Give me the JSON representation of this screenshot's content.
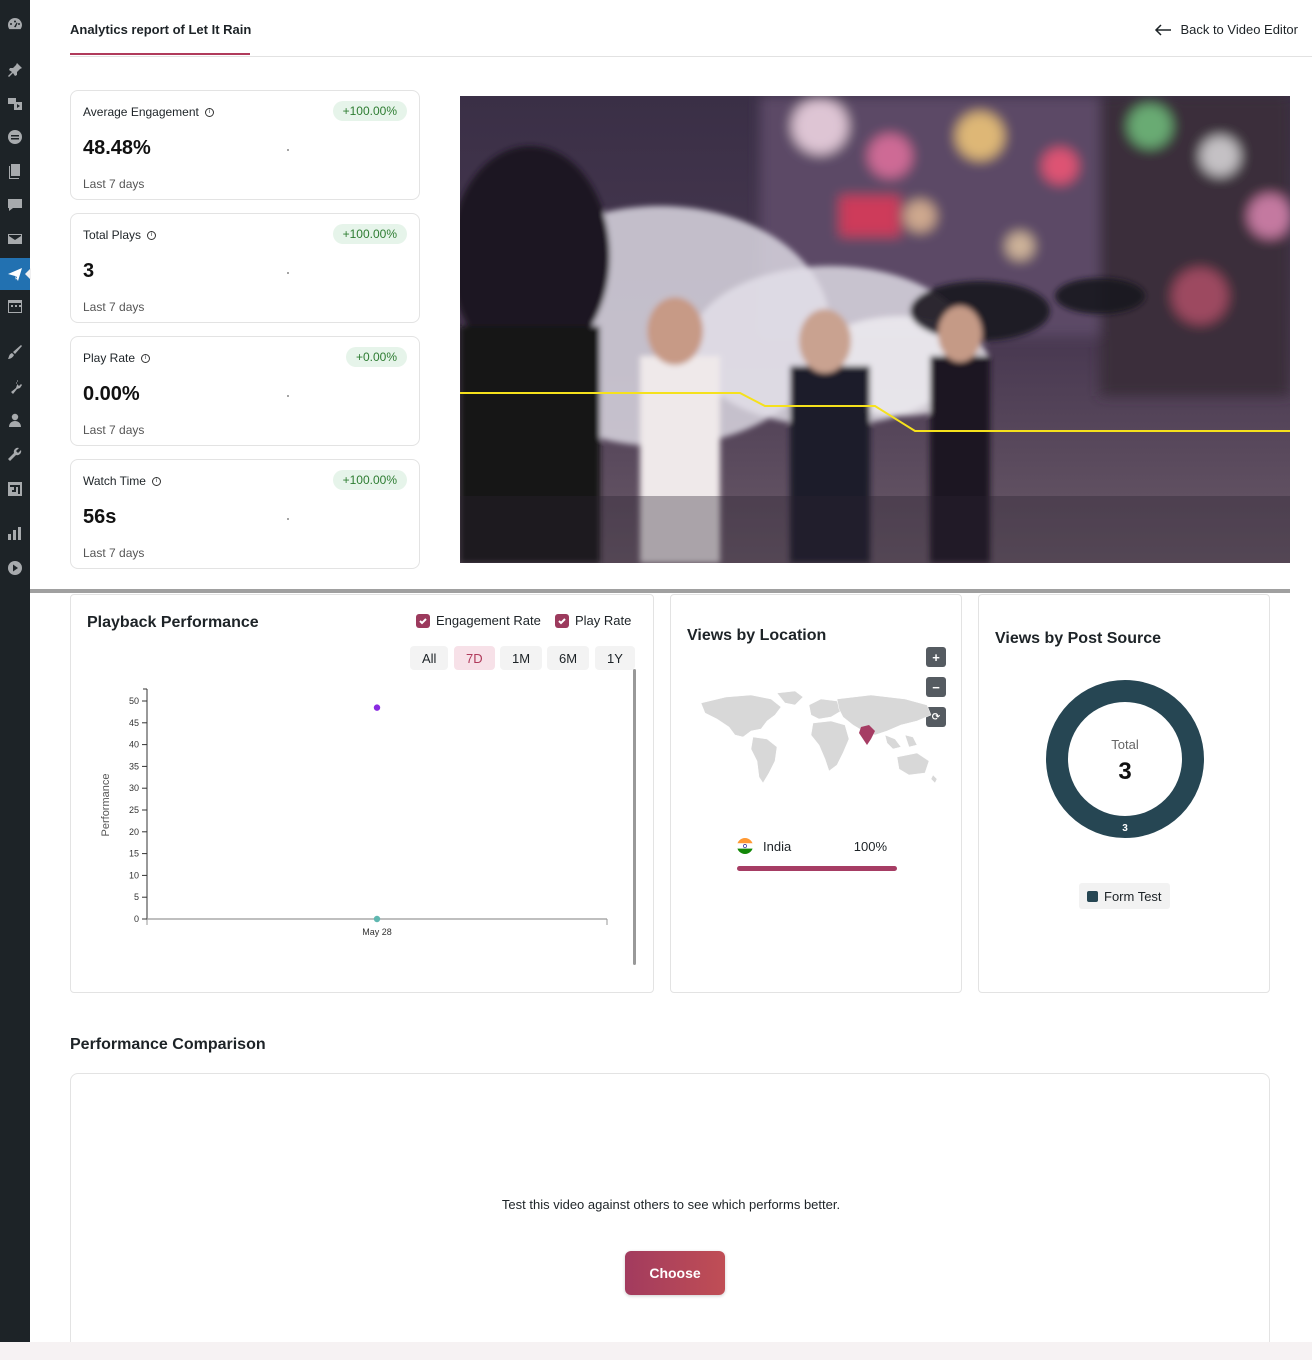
{
  "header": {
    "title": "Analytics report of Let It Rain",
    "back_label": "Back to Video Editor"
  },
  "stats": [
    {
      "label": "Average Engagement",
      "badge": "+100.00%",
      "value": "48.48%",
      "period": "Last 7 days"
    },
    {
      "label": "Total Plays",
      "badge": "+100.00%",
      "value": "3",
      "period": "Last 7 days"
    },
    {
      "label": "Play Rate",
      "badge": "+0.00%",
      "value": "0.00%",
      "period": "Last 7 days"
    },
    {
      "label": "Watch Time",
      "badge": "+100.00%",
      "value": "56s",
      "period": "Last 7 days"
    }
  ],
  "playback": {
    "title": "Playback Performance",
    "toggles": [
      "Engagement Rate",
      "Play Rate"
    ],
    "ranges": [
      "All",
      "7D",
      "1M",
      "6M",
      "1Y"
    ],
    "active_range": "7D"
  },
  "chart_data": {
    "type": "scatter",
    "ylabel": "Performance",
    "xlabel": "",
    "ylim": [
      0,
      50
    ],
    "yticks": [
      "0",
      "5",
      "10",
      "15",
      "20",
      "25",
      "30",
      "35",
      "40",
      "45",
      "50"
    ],
    "categories": [
      "May 28"
    ],
    "series": [
      {
        "name": "Engagement Rate",
        "values": [
          48.48
        ],
        "color": "#8a2be2"
      },
      {
        "name": "Play Rate",
        "values": [
          0
        ],
        "color": "#5fb7b0"
      }
    ]
  },
  "location": {
    "title": "Views by Location",
    "zoom_in": "+",
    "zoom_out": "−",
    "reset": "⟳",
    "items": [
      {
        "country": "India",
        "percent": "100%"
      }
    ],
    "highlight_color": "#a63d64"
  },
  "source": {
    "title": "Views by Post Source",
    "total_label": "Total",
    "total_value": "3",
    "slice_label": "3",
    "legend": "Form Test",
    "color": "#264653"
  },
  "comparison": {
    "title": "Performance Comparison",
    "text": "Test this video against others to see which performs better.",
    "button": "Choose"
  }
}
